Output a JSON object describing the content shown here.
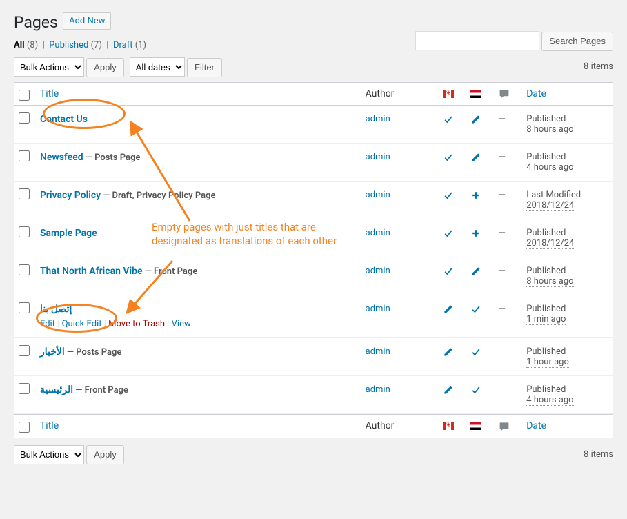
{
  "heading": "Pages",
  "addNew": "Add New",
  "filters": {
    "all": "All",
    "allCount": "(8)",
    "published": "Published",
    "publishedCount": "(7)",
    "draft": "Draft",
    "draftCount": "(1)"
  },
  "search": {
    "button": "Search Pages",
    "placeholder": ""
  },
  "bulk": {
    "label": "Bulk Actions",
    "apply": "Apply"
  },
  "dateFilter": {
    "label": "All dates",
    "filter": "Filter"
  },
  "itemsCount": "8 items",
  "columns": {
    "title": "Title",
    "author": "Author",
    "date": "Date"
  },
  "rows": [
    {
      "title": "Contact Us",
      "state": "",
      "author": "admin",
      "c1": "tick",
      "c2": "pencil",
      "dash": true,
      "status": "Published",
      "time": "8 hours ago",
      "actions": false
    },
    {
      "title": "Newsfeed",
      "state": " — Posts Page",
      "author": "admin",
      "c1": "tick",
      "c2": "pencil",
      "dash": true,
      "status": "Published",
      "time": "4 hours ago",
      "actions": false
    },
    {
      "title": "Privacy Policy",
      "state": " — Draft, Privacy Policy Page",
      "author": "admin",
      "c1": "tick",
      "c2": "plus",
      "dash": true,
      "status": "Last Modified",
      "time": "2018/12/24",
      "actions": false
    },
    {
      "title": "Sample Page",
      "state": "",
      "author": "admin",
      "c1": "tick",
      "c2": "plus",
      "dash": true,
      "status": "Published",
      "time": "2018/12/24",
      "actions": false
    },
    {
      "title": "That North African Vibe",
      "state": " — Front Page",
      "author": "admin",
      "c1": "tick",
      "c2": "pencil",
      "dash": true,
      "status": "Published",
      "time": "8 hours ago",
      "actions": false
    },
    {
      "title": "إتصل بنا",
      "state": "",
      "author": "admin",
      "c1": "pencil",
      "c2": "tick",
      "dash": true,
      "status": "Published",
      "time": "1 min ago",
      "actions": true
    },
    {
      "title": "الأخبار",
      "state": " — Posts Page",
      "author": "admin",
      "c1": "pencil",
      "c2": "tick",
      "dash": true,
      "status": "Published",
      "time": "1 hour ago",
      "actions": false
    },
    {
      "title": "الرئيسية",
      "state": " — Front Page",
      "author": "admin",
      "c1": "pencil",
      "c2": "tick",
      "dash": true,
      "status": "Published",
      "time": "4 hours ago",
      "actions": false
    }
  ],
  "rowActions": {
    "edit": "Edit",
    "quick": "Quick Edit",
    "trash": "Move to Trash",
    "view": "View"
  },
  "annotation": "Empty pages with just titles that are designated as translations of each other"
}
